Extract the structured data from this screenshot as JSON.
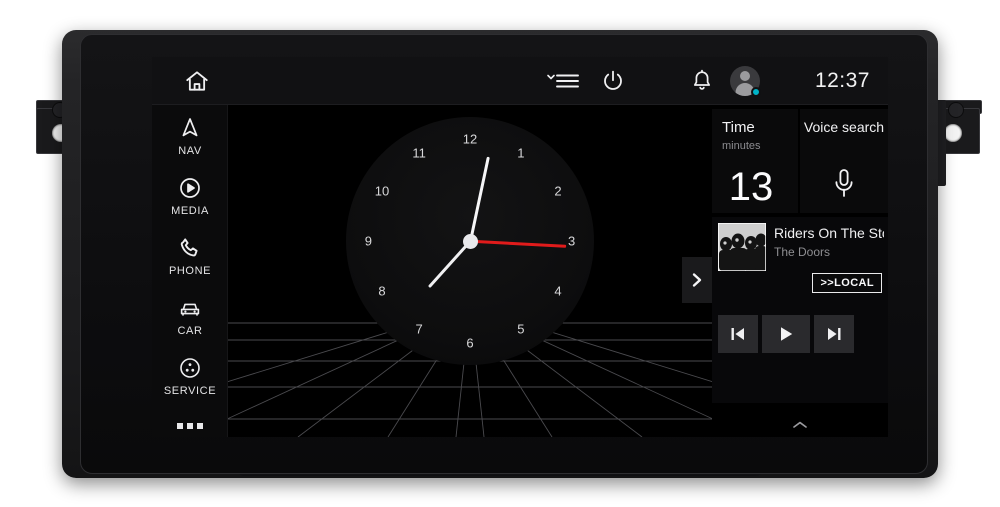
{
  "device": {
    "type": "car-head-unit",
    "bracket_icon": "mounting-bracket"
  },
  "topbar": {
    "home_icon": "home-icon",
    "menu_icon": "menu-chevron-icon",
    "power_icon": "power-icon",
    "notifications_icon": "bell-icon",
    "avatar_icon": "user-avatar-icon",
    "avatar_status_color": "#00b4c8",
    "time": "12:37"
  },
  "sidebar": {
    "items": [
      {
        "label": "NAV",
        "icon": "navigation-arrow-icon"
      },
      {
        "label": "MEDIA",
        "icon": "media-play-circle-icon"
      },
      {
        "label": "PHONE",
        "icon": "phone-handset-icon"
      },
      {
        "label": "CAR",
        "icon": "car-icon"
      },
      {
        "label": "SERVICE",
        "icon": "service-wheel-icon"
      }
    ],
    "more_label": "More",
    "more_icon": "more-dots-icon"
  },
  "clock": {
    "numbers": [
      "12",
      "1",
      "2",
      "3",
      "4",
      "5",
      "6",
      "7",
      "8",
      "9",
      "10",
      "11"
    ],
    "hour_angle_deg": 222,
    "minute_angle_deg": 12,
    "second_angle_deg": 93,
    "hand_colors": {
      "hour": "#f0f0f2",
      "minute": "#f6f6f8",
      "second": "#e01b1b"
    },
    "expand_icon": "chevron-right-icon"
  },
  "widgets": {
    "time_card": {
      "title": "Time",
      "subtitle": "minutes",
      "value": "13"
    },
    "voice_card": {
      "title": "Voice search",
      "icon": "microphone-icon"
    }
  },
  "media": {
    "album_art_icon": "album-art-thumbnail",
    "track_title": "Riders On The Storm",
    "artist": "The Doors",
    "source_badge": ">>LOCAL",
    "controls": [
      {
        "name": "previous",
        "icon": "skip-previous-icon"
      },
      {
        "name": "play",
        "icon": "play-icon"
      },
      {
        "name": "next",
        "icon": "skip-next-icon"
      }
    ],
    "expand_icon": "chevron-up-icon"
  }
}
